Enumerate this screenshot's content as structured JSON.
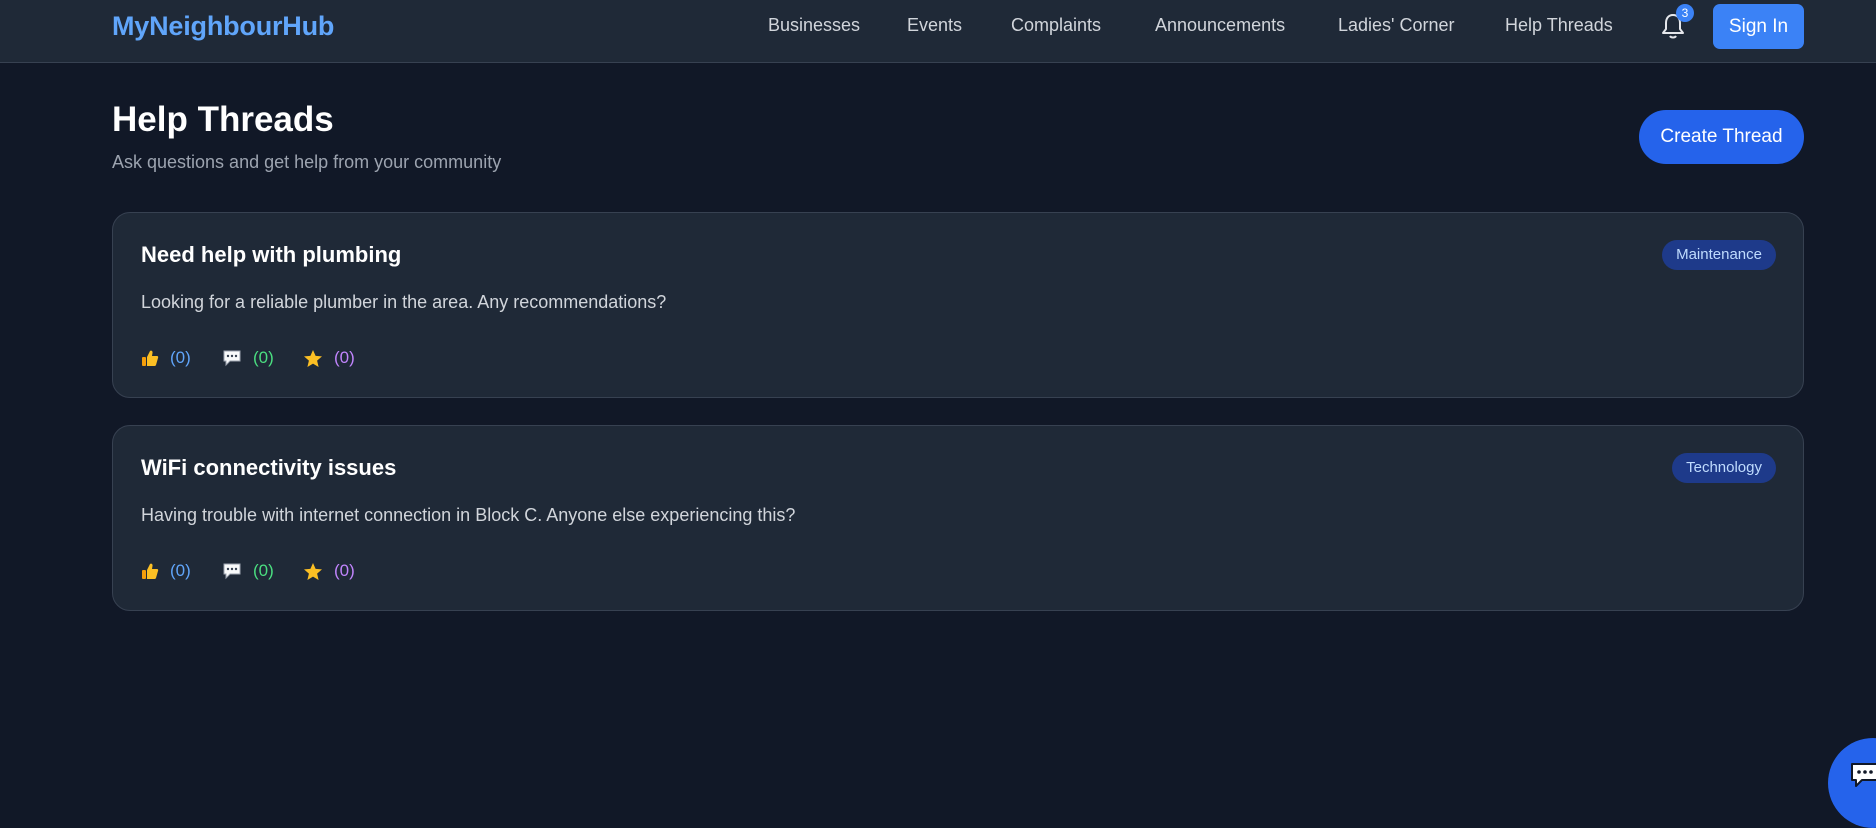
{
  "nav": {
    "brand": "MyNeighbourHub",
    "links": [
      "Businesses",
      "Events",
      "Complaints",
      "Announcements",
      "Ladies' Corner",
      "Help Threads"
    ],
    "notification_count": "3",
    "sign_in": "Sign In"
  },
  "header": {
    "title": "Help Threads",
    "subtitle": "Ask questions and get help from your community",
    "create_button": "Create Thread"
  },
  "threads": [
    {
      "title": "Need help with plumbing",
      "category": "Maintenance",
      "body": "Looking for a reliable plumber in the area. Any recommendations?",
      "likes": "(0)",
      "comments": "(0)",
      "stars": "(0)"
    },
    {
      "title": "WiFi connectivity issues",
      "category": "Technology",
      "body": "Having trouble with internet connection in Block C. Anyone else experiencing this?",
      "likes": "(0)",
      "comments": "(0)",
      "stars": "(0)"
    }
  ],
  "icons": {
    "bell": "bell-icon",
    "like": "thumbs-up-icon",
    "comment": "comment-icon",
    "star": "star-icon",
    "chat": "chat-icon"
  },
  "colors": {
    "accent": "#3b82f6",
    "likes": "#60a5fa",
    "comments": "#4ade80",
    "stars": "#c084fc"
  }
}
